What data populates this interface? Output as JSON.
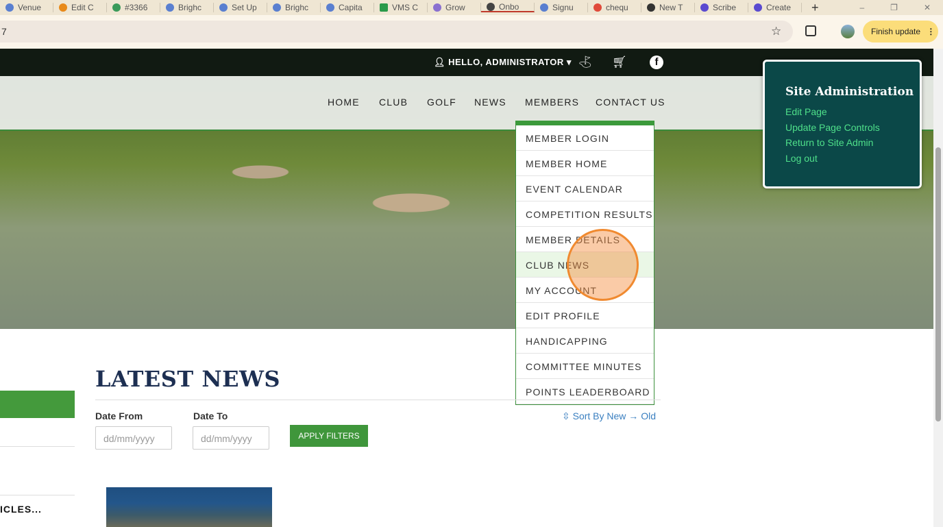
{
  "browser": {
    "tabs": [
      "Venue",
      "Edit C",
      "#3366",
      "Brighc",
      "Set Up",
      "Brighc",
      "Capita",
      "VMS C",
      "Grow",
      "Onbo",
      "Signu",
      "chequ",
      "New T",
      "Scribe",
      "Create"
    ],
    "url": "7",
    "finish_update": "Finish update"
  },
  "topbar": {
    "greeting": "HELLO, ADMINISTRATOR ▾"
  },
  "nav": [
    "HOME",
    "CLUB",
    "GOLF",
    "NEWS",
    "MEMBERS",
    "CONTACT US"
  ],
  "members_menu": [
    "MEMBER LOGIN",
    "MEMBER HOME",
    "EVENT CALENDAR",
    "COMPETITION RESULTS",
    "MEMBER DETAILS",
    "CLUB NEWS",
    "MY ACCOUNT",
    "EDIT PROFILE",
    "HANDICAPPING",
    "COMMITTEE MINUTES",
    "POINTS LEADERBOARD"
  ],
  "admin": {
    "title": "Site Administration",
    "links": [
      "Edit Page",
      "Update Page Controls",
      "Return to Site Admin",
      "Log out"
    ]
  },
  "main": {
    "title": "LATEST NEWS",
    "date_from_label": "Date From",
    "date_to_label": "Date To",
    "placeholder": "dd/mm/yyyy",
    "apply": "APPLY FILTERS",
    "sort": "⇳ Sort By New → Old",
    "sidebar_articles": "ICLES..."
  }
}
